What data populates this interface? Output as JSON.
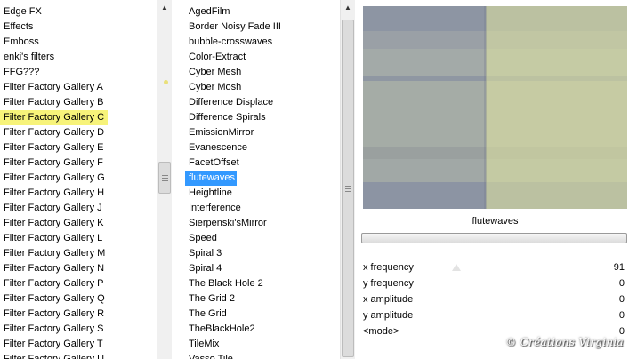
{
  "categories": {
    "items": [
      "Edge FX",
      "Effects",
      "Emboss",
      "enki's filters",
      "FFG???",
      "Filter Factory Gallery A",
      "Filter Factory Gallery B",
      "Filter Factory Gallery C",
      "Filter Factory Gallery D",
      "Filter Factory Gallery E",
      "Filter Factory Gallery F",
      "Filter Factory Gallery G",
      "Filter Factory Gallery H",
      "Filter Factory Gallery J",
      "Filter Factory Gallery K",
      "Filter Factory Gallery L",
      "Filter Factory Gallery M",
      "Filter Factory Gallery N",
      "Filter Factory Gallery P",
      "Filter Factory Gallery Q",
      "Filter Factory Gallery R",
      "Filter Factory Gallery S",
      "Filter Factory Gallery T",
      "Filter Factory Gallery U"
    ],
    "selected": "Filter Factory Gallery C",
    "highlight_color": "#f7f37a"
  },
  "filters": {
    "items": [
      "AgedFilm",
      "Border Noisy Fade III",
      "bubble-crosswaves",
      "Color-Extract",
      "Cyber Mesh",
      "Cyber Mosh",
      "Difference Displace",
      "Difference Spirals",
      "EmissionMirror",
      "Evanescence",
      "FacetOffset",
      "flutewaves",
      "Heightline",
      "Interference",
      "Sierpenski'sMirror",
      "Speed",
      "Spiral 3",
      "Spiral 4",
      "The Black Hole 2",
      "The Grid 2",
      "The Grid",
      "TheBlackHole2",
      "TileMix",
      "Vasso Tile"
    ],
    "selected": "flutewaves",
    "highlight_color": "#3399ff"
  },
  "preview": {
    "filter_name": "flutewaves"
  },
  "sliders": [
    {
      "label": "x frequency",
      "value": "91"
    },
    {
      "label": "y frequency",
      "value": "0"
    },
    {
      "label": "x amplitude",
      "value": "0"
    },
    {
      "label": "y amplitude",
      "value": "0"
    },
    {
      "label": "<mode>",
      "value": "0"
    }
  ],
  "watermark": "© Créations Virginia"
}
